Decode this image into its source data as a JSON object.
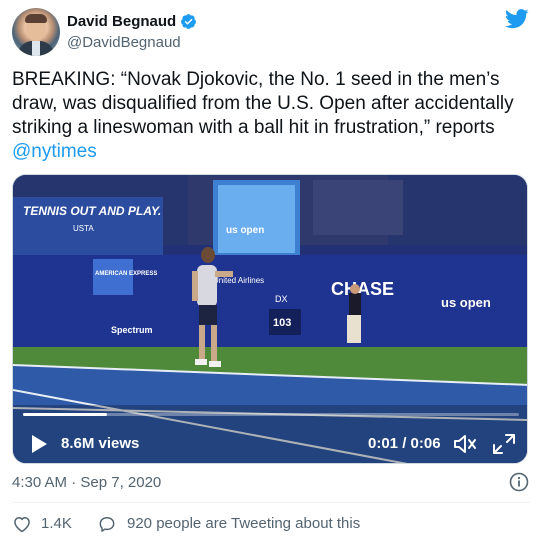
{
  "author": {
    "display_name": "David Begnaud",
    "handle": "@DavidBegnaud",
    "verified": true
  },
  "tweet": {
    "text_prefix": "BREAKING: “Novak Djokovic, the No. 1 seed in the men’s draw, was disqualified from the U.S. Open after accidentally striking a lineswoman with a ball hit in frustration,” reports ",
    "mention": "@nytimes"
  },
  "video": {
    "views": "8.6M views",
    "time": "0:01 / 0:06",
    "progress_fraction": 0.17,
    "scene_text": {
      "banner": "TENNIS OUT AND PLAY.",
      "banner_sub": "USTA",
      "amex": "AMERICAN EXPRESS",
      "screen_brand": "us open",
      "sponsor1": "United Airlines",
      "sponsor2": "CHASE",
      "sponsor3": "us open",
      "spectrum": "Spectrum",
      "speed_label": "DX",
      "speed_value": "103"
    }
  },
  "meta": {
    "timestamp": "4:30 AM · Sep 7, 2020"
  },
  "actions": {
    "like_count": "1.4K",
    "reply_text": "920 people are Tweeting about this"
  },
  "icons": {
    "verified": "verified-badge-icon",
    "brand": "twitter-bird-icon",
    "play": "play-icon",
    "volume": "volume-icon",
    "fullscreen": "fullscreen-icon",
    "info": "info-icon",
    "like": "heart-icon",
    "reply": "speech-bubble-icon"
  },
  "colors": {
    "accent": "#1d9bf0",
    "text": "#0f1419",
    "secondary": "#536471",
    "court_blue": "#2a4f9c",
    "court_green": "#4f8a3b"
  }
}
